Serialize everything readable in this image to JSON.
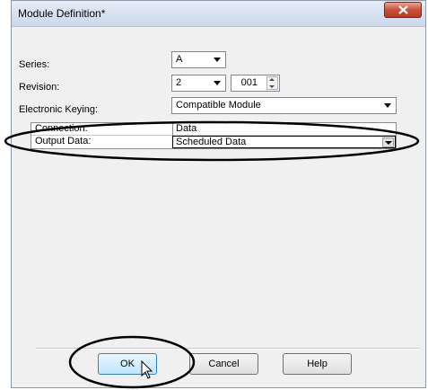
{
  "window": {
    "title": "Module Definition*"
  },
  "fields": {
    "series": {
      "label": "Series:",
      "value": "A"
    },
    "revision": {
      "label": "Revision:",
      "major": "2",
      "minor": "001"
    },
    "keying": {
      "label": "Electronic Keying:",
      "value": "Compatible Module"
    }
  },
  "grid": {
    "rows": [
      {
        "label": "Connection:",
        "value": "Data"
      },
      {
        "label": "Output Data:",
        "value": "Scheduled Data"
      }
    ]
  },
  "buttons": {
    "ok": "OK",
    "cancel": "Cancel",
    "help": "Help"
  },
  "icons": {
    "close": "close-icon",
    "dropdown": "chevron-down-icon",
    "spin": "spin-arrows-icon",
    "cursor": "mouse-pointer-icon"
  },
  "colors": {
    "title_bar": "#cbd8ea",
    "close_button": "#c8503a",
    "dialog_bg": "#f0f0f0",
    "annotation": "#000000"
  }
}
